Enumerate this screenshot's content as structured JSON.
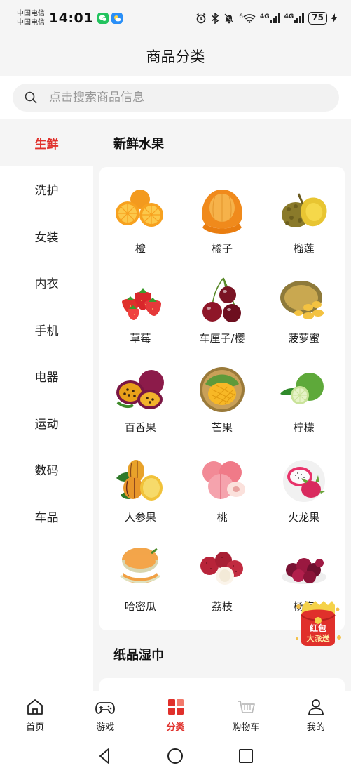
{
  "status_bar": {
    "carrier1": "中国电信",
    "carrier2": "中国电信",
    "time": "14:01",
    "network1": "4G",
    "network2": "4G",
    "wifi_label": "6",
    "battery": "75"
  },
  "header": {
    "title": "商品分类"
  },
  "search": {
    "placeholder": "点击搜索商品信息"
  },
  "sidebar": {
    "items": [
      {
        "label": "生鲜",
        "active": true
      },
      {
        "label": "洗护"
      },
      {
        "label": "女装"
      },
      {
        "label": "内衣"
      },
      {
        "label": "手机"
      },
      {
        "label": "电器"
      },
      {
        "label": "运动"
      },
      {
        "label": "数码"
      },
      {
        "label": "车品"
      }
    ]
  },
  "main": {
    "section1_title": "新鲜水果",
    "products": [
      {
        "label": "橙",
        "icon": "orange-icon"
      },
      {
        "label": "橘子",
        "icon": "tangerine-icon"
      },
      {
        "label": "榴莲",
        "icon": "durian-icon"
      },
      {
        "label": "草莓",
        "icon": "strawberry-icon"
      },
      {
        "label": "车厘子/樱",
        "icon": "cherry-icon"
      },
      {
        "label": "菠萝蜜",
        "icon": "jackfruit-icon"
      },
      {
        "label": "百香果",
        "icon": "passion-fruit-icon"
      },
      {
        "label": "芒果",
        "icon": "mango-icon"
      },
      {
        "label": "柠檬",
        "icon": "lemon-icon"
      },
      {
        "label": "人参果",
        "icon": "pepino-icon"
      },
      {
        "label": "桃",
        "icon": "peach-icon"
      },
      {
        "label": "火龙果",
        "icon": "dragon-fruit-icon"
      },
      {
        "label": "哈密瓜",
        "icon": "melon-icon"
      },
      {
        "label": "荔枝",
        "icon": "lychee-icon"
      },
      {
        "label": "杨梅",
        "icon": "bayberry-icon"
      }
    ],
    "section2_title": "纸品湿巾"
  },
  "red_packet": {
    "line1": "红包",
    "line2": "大派送"
  },
  "tabbar": {
    "items": [
      {
        "label": "首页",
        "icon": "home-icon"
      },
      {
        "label": "游戏",
        "icon": "gamepad-icon"
      },
      {
        "label": "分类",
        "icon": "category-icon",
        "active": true
      },
      {
        "label": "购物车",
        "icon": "cart-icon"
      },
      {
        "label": "我的",
        "icon": "user-icon"
      }
    ]
  },
  "colors": {
    "accent": "#e0302b",
    "background": "#f5f5f5",
    "card": "#ffffff"
  }
}
